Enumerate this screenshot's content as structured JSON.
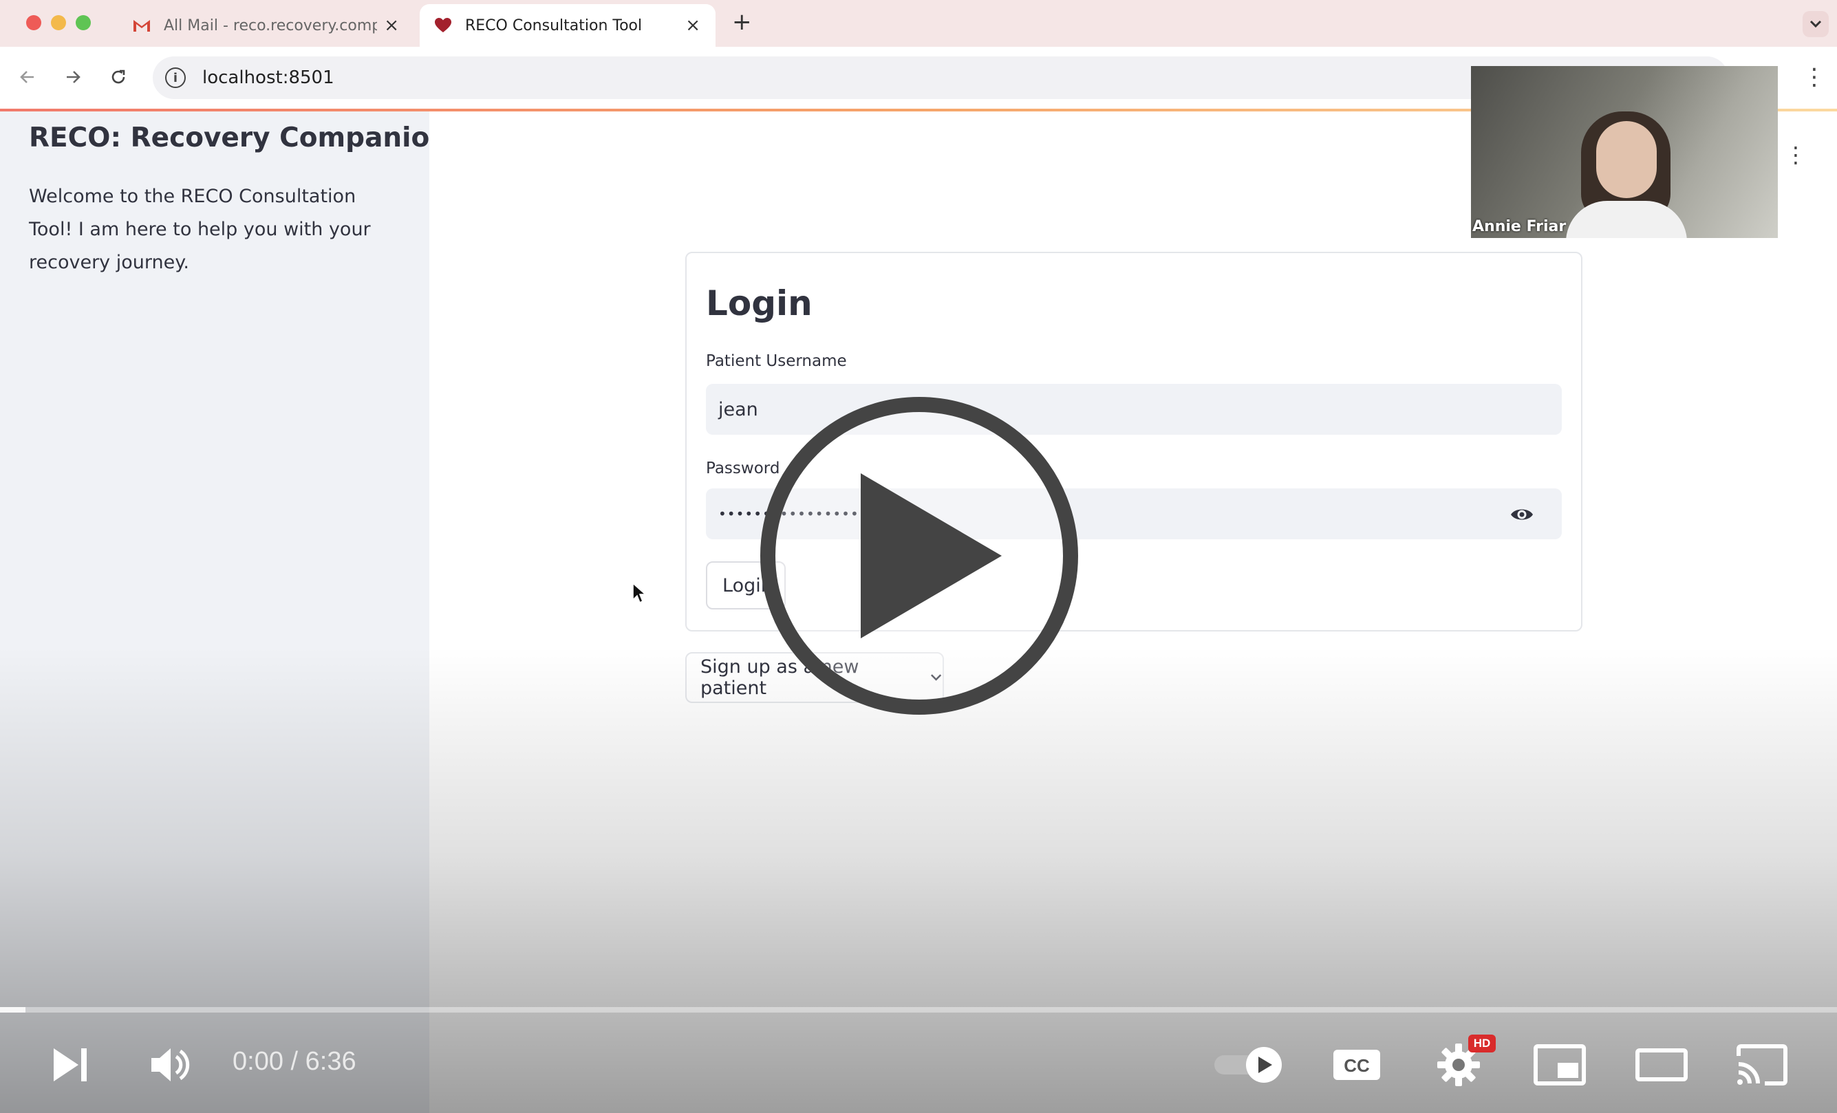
{
  "browser": {
    "tabs": [
      {
        "title": "All Mail - reco.recovery.comp",
        "favicon": "gmail-icon",
        "active": false
      },
      {
        "title": "RECO Consultation Tool",
        "favicon": "heart-icon",
        "active": true
      }
    ],
    "url": "localhost:8501"
  },
  "sidebar": {
    "title": "RECO: Recovery Companion",
    "welcome": "Welcome to the RECO Consultation Tool! I am here to help you with your recovery journey."
  },
  "login": {
    "title": "Login",
    "username_label": "Patient Username",
    "username_value": "jean",
    "password_label": "Password",
    "password_value": "••••••••••••••••",
    "button_label": "Login"
  },
  "signup": {
    "label": "Sign up as a new patient"
  },
  "webcam": {
    "name": "Annie Friar"
  },
  "video": {
    "time_current": "0:00",
    "time_total": "6:36",
    "time_display": "0:00 / 6:36",
    "progress": 0.014,
    "hd_badge": "HD"
  },
  "colors": {
    "accent": "#ff4b4b",
    "sidebar_bg": "#f0f2f6",
    "tabbar_bg": "#f5e6e6"
  }
}
